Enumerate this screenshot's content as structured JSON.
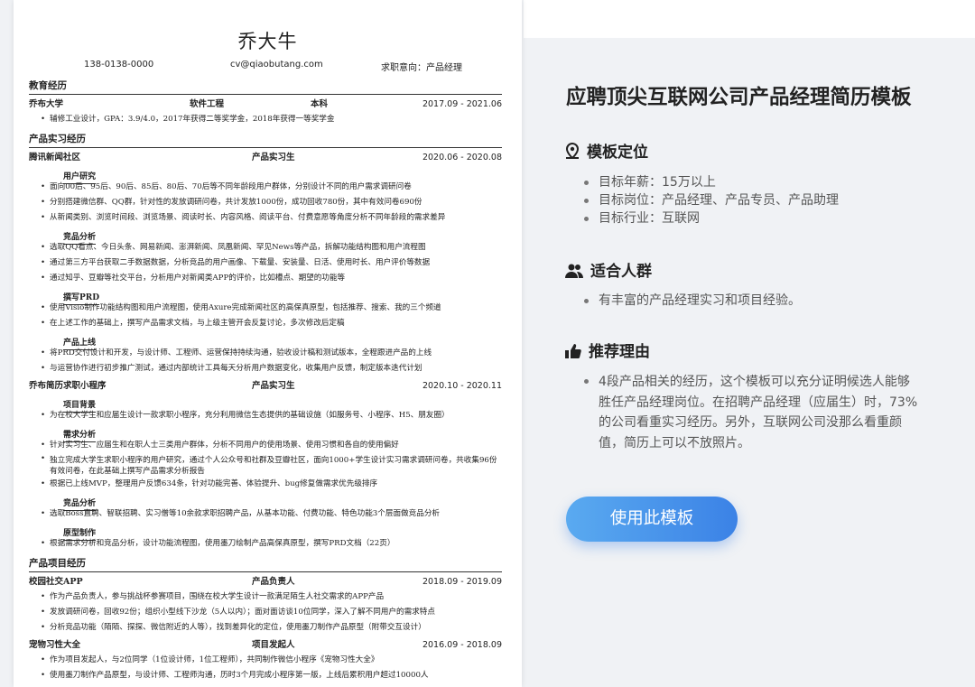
{
  "resume": {
    "name": "乔大牛",
    "phone": "138-0138-0000",
    "email": "cv@qiaobutang.com",
    "intent": "求职意向：产品经理",
    "education": {
      "heading": "教育经历",
      "school": "乔布大学",
      "major": "软件工程",
      "degree": "本科",
      "period": "2017.09 - 2021.06",
      "bullet": "辅修工业设计，GPA：3.9/4.0，2017年获得二等奖学金，2018年获得一等奖学金"
    },
    "internship": {
      "heading": "产品实习经历",
      "job1": {
        "org": "腾讯新闻社区",
        "role": "产品实习生",
        "period": "2020.06 - 2020.08"
      },
      "job1_sections": [
        {
          "title": "用户研究",
          "bullets": [
            "面向00后、95后、90后、85后、80后、70后等不同年龄段用户群体，分别设计不同的用户需求调研问卷",
            "分别搭建微信群、QQ群，针对性的发放调研问卷，共计发放1000份，成功回收780份，其中有效问卷690份",
            "从新闻类别、浏览时间段、浏览场景、阅读时长、内容风格、阅读平台、付费意愿等角度分析不同年龄段的需求差异"
          ]
        },
        {
          "title": "竞品分析",
          "bullets": [
            "选取QQ看点、今日头条、网易新闻、澎湃新闻、凤凰新闻、罕见News等产品，拆解功能结构图和用户流程图",
            "通过第三方平台获取二手数据数据，分析竞品的用户画像、下载量、安装量、日活、使用时长、用户评价等数据",
            "通过知乎、豆瓣等社交平台，分析用户对新闻类APP的评价，比如槽点、期望的功能等"
          ]
        },
        {
          "title": "撰写PRD",
          "bullets": [
            "使用Visio制作功能结构图和用户流程图，使用Axure完成新闻社区的高保真原型，包括推荐、搜索、我的三个频道",
            "在上述工作的基础上，撰写产品需求文档，与上级主管开会反复讨论，多次修改后定稿"
          ]
        },
        {
          "title": "产品上线",
          "bullets": [
            "将PRD交付设计和开发，与设计师、工程师、运营保持持续沟通，验收设计稿和测试版本，全程跟进产品的上线",
            "与运营协作进行初步推广测试，通过内部统计工具每天分析用户数据变化，收集用户反馈，制定版本迭代计划"
          ]
        }
      ],
      "job2": {
        "org": "乔布简历求职小程序",
        "role": "产品实习生",
        "period": "2020.10 - 2020.11"
      },
      "job2_sections": [
        {
          "title": "项目背景",
          "bullets": [
            "为在校大学生和应届生设计一款求职小程序，充分利用微信生态提供的基础设施（如服务号、小程序、H5、朋友圈）"
          ]
        },
        {
          "title": "需求分析",
          "bullets": [
            "针对实习生、应届生和在职人士三类用户群体，分析不同用户的使用场景、使用习惯和各自的使用偏好",
            "独立完成大学生求职小程序的用户研究，通过个人公众号和社群及豆瓣社区，面向1000+学生设计实习需求调研问卷，共收集96份有效问卷，在此基础上撰写产品需求分析报告",
            "根据已上线MVP，整理用户反馈634条，针对功能完善、体验提升、bug修复做需求优先级排序"
          ]
        },
        {
          "title": "竞品分析",
          "bullets": [
            "选取Boss直聘、智联招聘、实习僧等10余款求职招聘产品，从基本功能、付费功能、特色功能3个层面做竞品分析"
          ]
        },
        {
          "title": "原型制作",
          "bullets": [
            "根据需求分析和竞品分析，设计功能流程图，使用墨刀绘制产品高保真原型，撰写PRD文档（22页）"
          ]
        }
      ]
    },
    "projects": {
      "heading": "产品项目经历",
      "p1": {
        "name": "校园社交APP",
        "role": "产品负责人",
        "period": "2018.09 - 2019.09"
      },
      "p1_bullets": [
        "作为产品负责人，参与挑战杯参赛项目，围绕在校大学生设计一款满足陌生人社交需求的APP产品",
        "发放调研问卷，回收92份；组织小型线下沙龙（5人以内）；面对面访谈10位同学，深入了解不同用户的需求特点",
        "分析竞品功能（陌陌、探探、微信附近的人等），找到差异化的定位，使用墨刀制作产品原型（附带交互设计）"
      ],
      "p2": {
        "name": "宠物习性大全",
        "role": "项目发起人",
        "period": "2016.09 - 2018.09"
      },
      "p2_bullets": [
        "作为项目发起人，与2位同学（1位设计师，1位工程师），共同制作微信小程序《宠物习性大全》",
        "使用墨刀制作产品原型，与设计师、工程师沟通，历时3个月完成小程序第一版，上线后累积用户超过10000人"
      ]
    }
  },
  "side": {
    "title": "应聘顶尖互联网公司产品经理简历模板",
    "section1": {
      "heading": "模板定位",
      "items": [
        "目标年薪：15万以上",
        "目标岗位：产品经理、产品专员、产品助理",
        "目标行业：互联网"
      ]
    },
    "section2": {
      "heading": "适合人群",
      "items": [
        "有丰富的产品经理实习和项目经验。"
      ]
    },
    "section3": {
      "heading": "推荐理由",
      "text": "4段产品相关的经历，这个模板可以充分证明候选人能够胜任产品经理岗位。在招聘产品经理（应届生）时，73%的公司看重实习经历。另外，互联网公司没那么看重颜值，简历上可以不放照片。"
    },
    "cta_label": "使用此模板",
    "accent": "#3b82e6"
  }
}
